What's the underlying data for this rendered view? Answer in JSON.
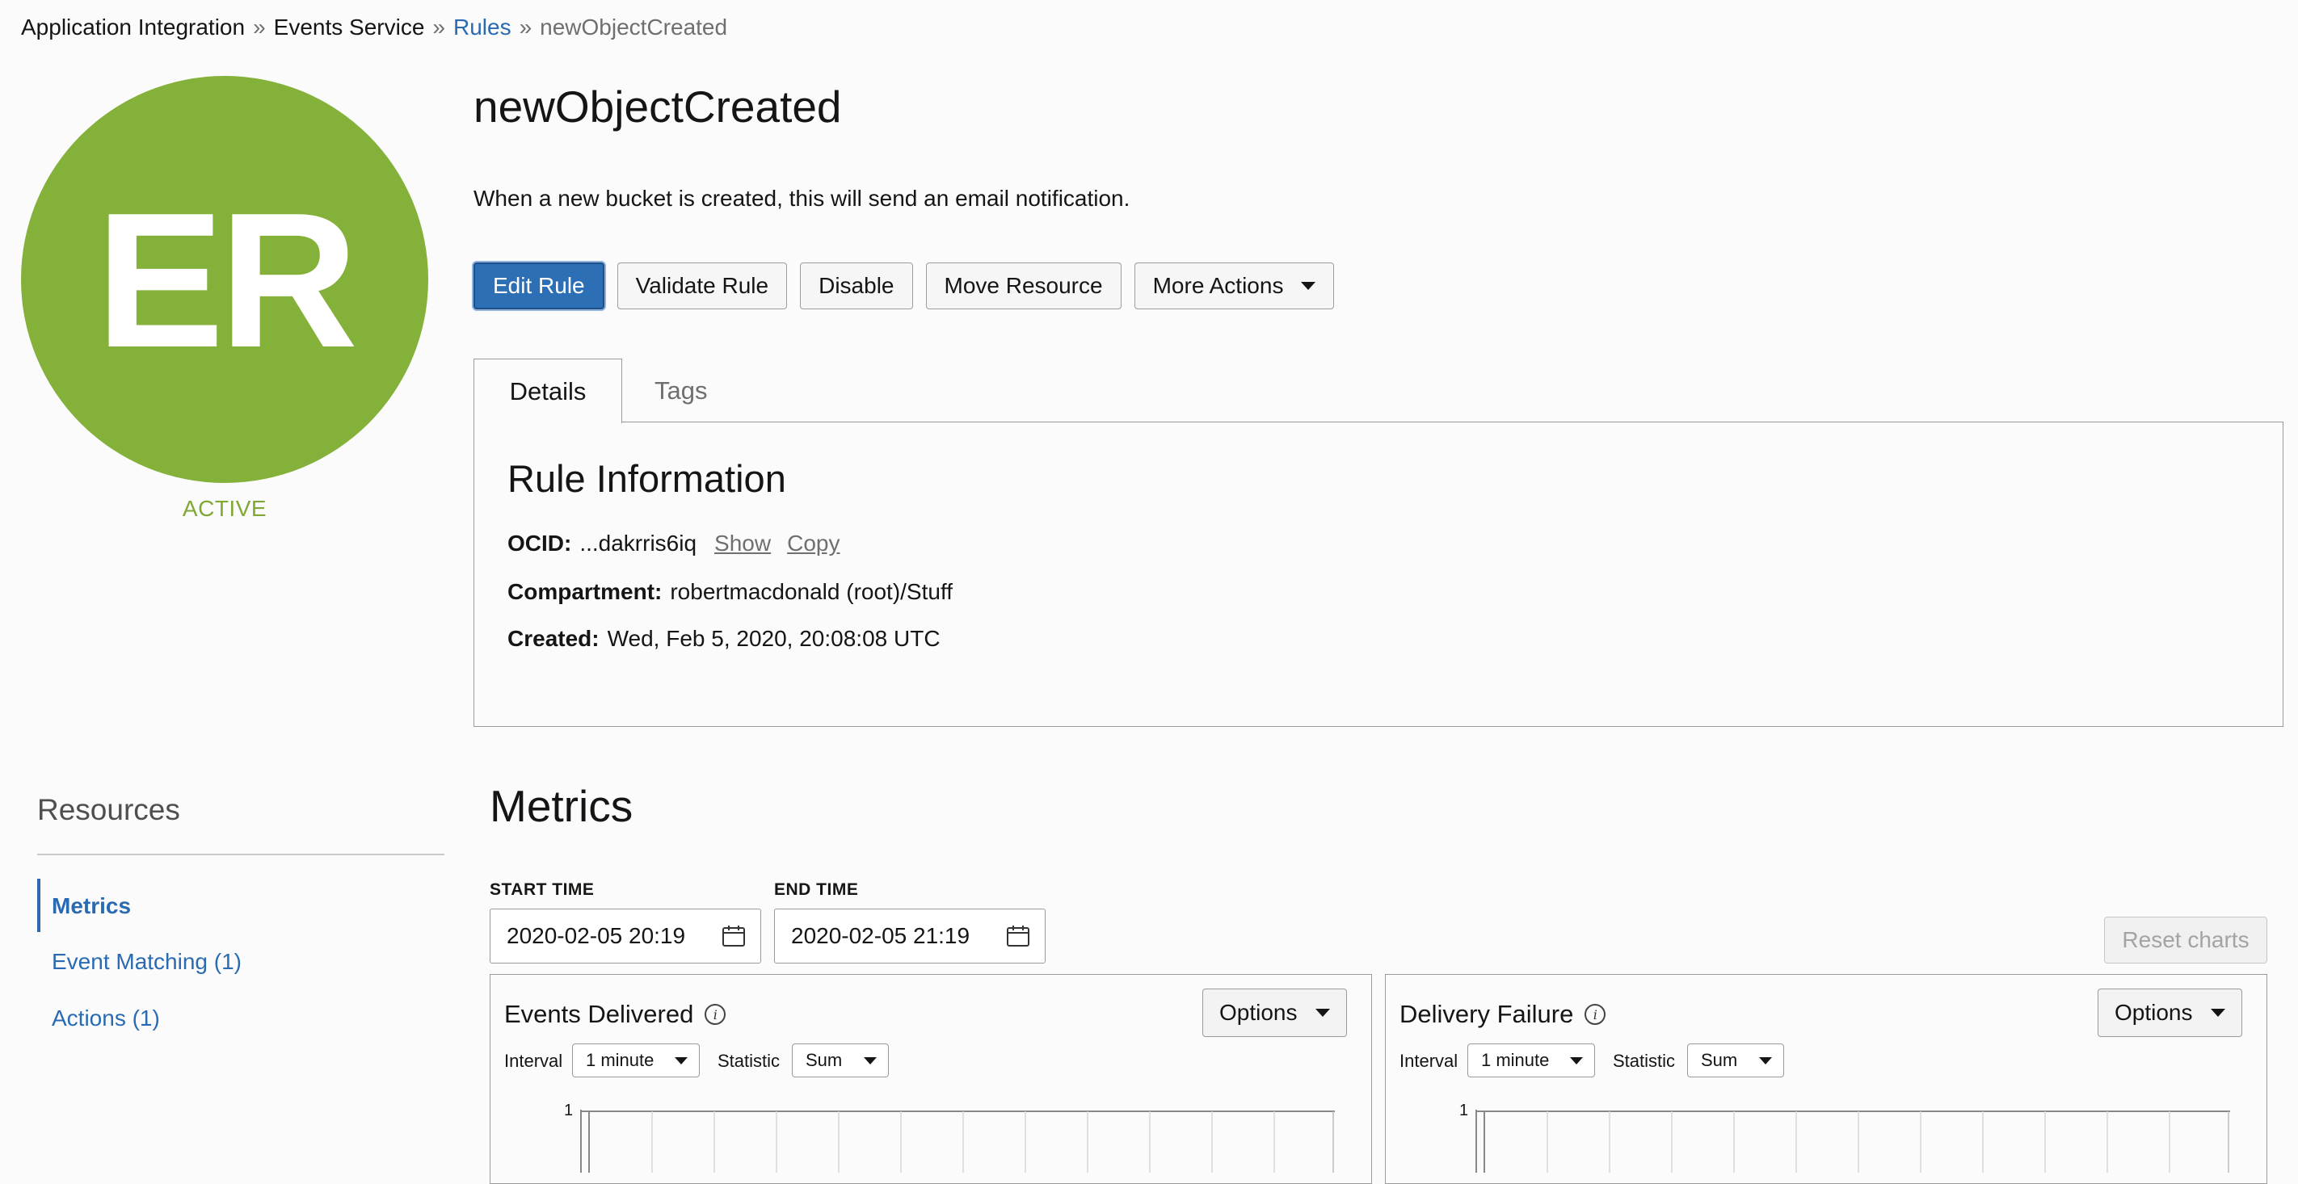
{
  "breadcrumb": {
    "items": [
      "Application Integration",
      "Events Service",
      "Rules"
    ],
    "separator": "»",
    "current": "newObjectCreated"
  },
  "avatar": {
    "initials": "ER",
    "color": "#84b13a"
  },
  "status": "ACTIVE",
  "header": {
    "title": "newObjectCreated",
    "description": "When a new bucket is created, this will send an email notification."
  },
  "actions": {
    "edit": "Edit Rule",
    "validate": "Validate Rule",
    "disable": "Disable",
    "move": "Move Resource",
    "more": "More Actions"
  },
  "tabs": {
    "details": "Details",
    "tags": "Tags"
  },
  "info": {
    "title": "Rule Information",
    "ocid_label": "OCID:",
    "ocid_value": "...dakrris6iq",
    "show": "Show",
    "copy": "Copy",
    "compartment_label": "Compartment:",
    "compartment_value": "robertmacdonald (root)/Stuff",
    "created_label": "Created:",
    "created_value": "Wed, Feb 5, 2020, 20:08:08 UTC"
  },
  "resources": {
    "title": "Resources",
    "items": [
      "Metrics",
      "Event Matching (1)",
      "Actions (1)"
    ]
  },
  "metrics": {
    "title": "Metrics",
    "start_label": "START TIME",
    "start_value": "2020-02-05 20:19",
    "end_label": "END TIME",
    "end_value": "2020-02-05 21:19",
    "reset": "Reset charts",
    "charts": [
      {
        "title": "Events Delivered",
        "options": "Options",
        "interval_label": "Interval",
        "interval": "1 minute",
        "statistic_label": "Statistic",
        "statistic": "Sum",
        "ymax": "1"
      },
      {
        "title": "Delivery Failure",
        "options": "Options",
        "interval_label": "Interval",
        "interval": "1 minute",
        "statistic_label": "Statistic",
        "statistic": "Sum",
        "ymax": "1"
      }
    ]
  },
  "colors": {
    "accent": "#2a6ab3",
    "primary_button": "#2d6fb4",
    "status_active": "#7fa834"
  }
}
